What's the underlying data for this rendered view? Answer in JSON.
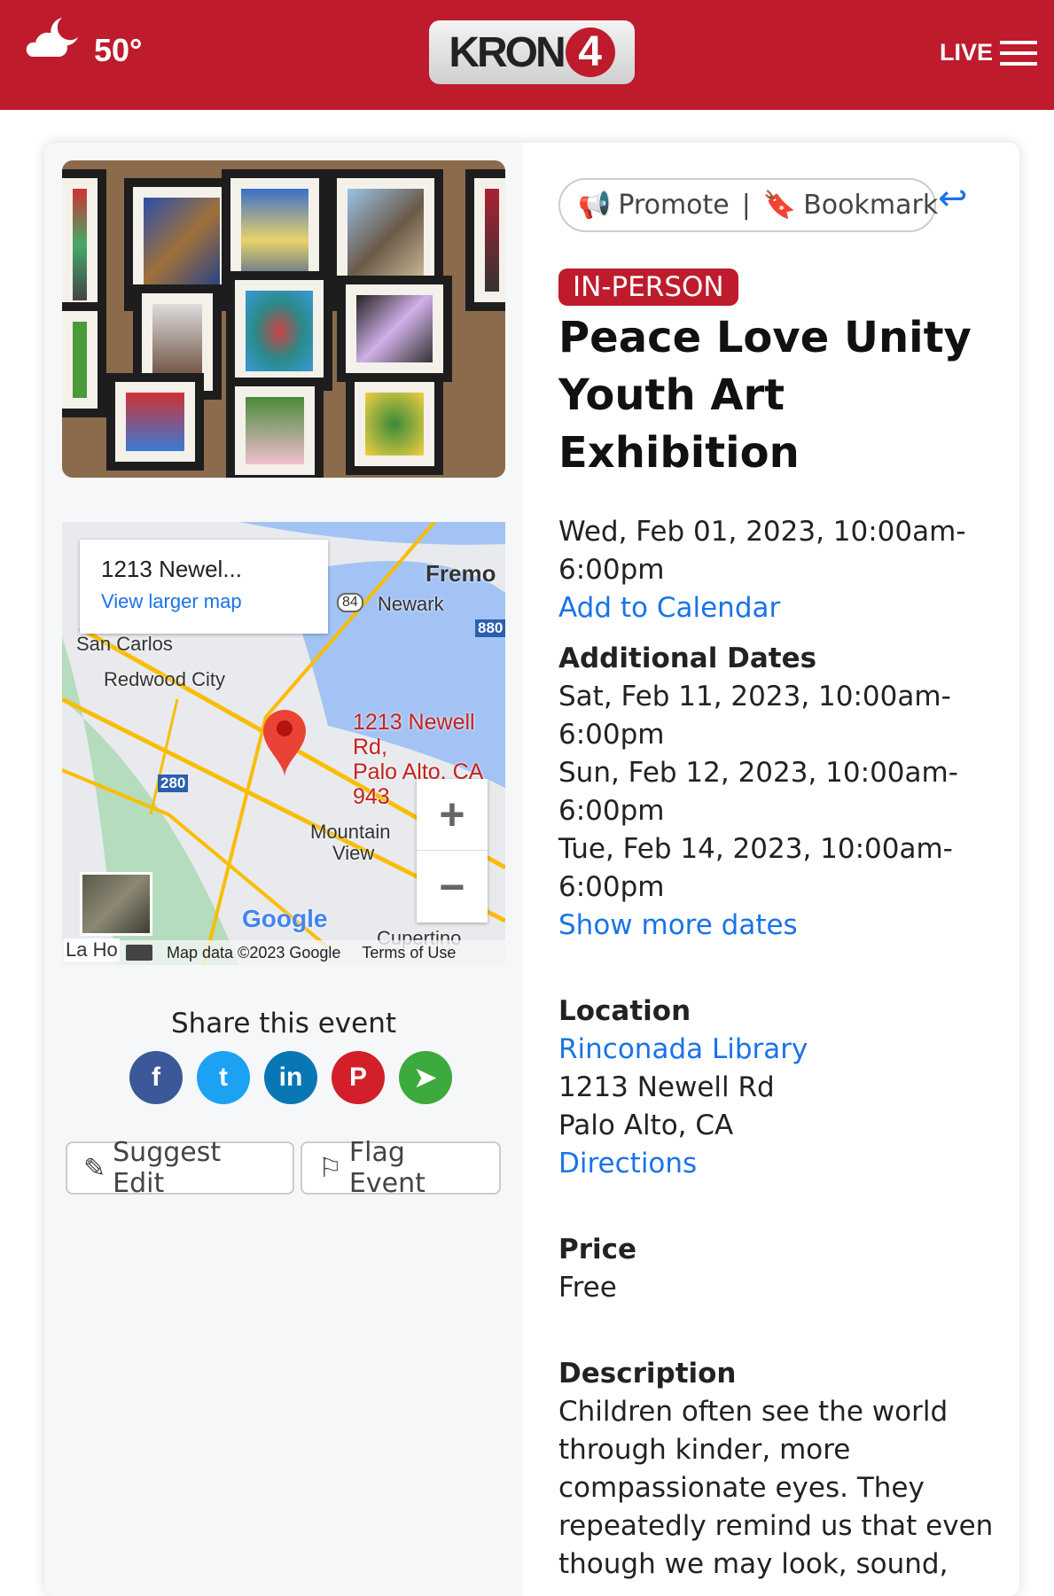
{
  "header": {
    "temperature": "50°",
    "weather_icon": "cloud-moon-icon",
    "logo_text": "KRON",
    "logo_number": "4",
    "live_label": "LIVE",
    "menu_icon": "hamburger-icon",
    "brand_color": "#BE1B2C"
  },
  "map": {
    "info_title": "1213 Newel...",
    "view_larger": "View larger map",
    "pin_label_1": "1213 Newell Rd,",
    "pin_label_2": "Palo Alto, CA 943",
    "places": [
      "Fremo",
      "Newark",
      "San Carlos",
      "Redwood City",
      "Mountain",
      "View",
      "Cupertino",
      "La Ho"
    ],
    "highways": [
      "84",
      "880",
      "280"
    ],
    "google": "Google",
    "map_data": "Map data ©2023 Google",
    "terms": "Terms of Use",
    "zoom_in": "+",
    "zoom_out": "−"
  },
  "share": {
    "title": "Share this event",
    "networks": [
      "facebook",
      "twitter",
      "linkedin",
      "pinterest",
      "telegram"
    ],
    "icons": [
      "f",
      "t",
      "in",
      "P",
      "➤"
    ]
  },
  "actions": {
    "suggest_edit": "Suggest Edit",
    "flag_event": "Flag Event",
    "promote": "Promote",
    "bookmark": "Bookmark",
    "separator": "|"
  },
  "event": {
    "badge": "IN-PERSON",
    "title": "Peace Love Unity Youth Art Exhibition",
    "date": "Wed, Feb 01, 2023, 10:00am-6:00pm",
    "add_calendar": "Add to Calendar",
    "additional_heading": "Additional Dates",
    "additional_dates": [
      "Sat, Feb 11, 2023, 10:00am-6:00pm",
      "Sun, Feb 12, 2023, 10:00am-6:00pm",
      "Tue, Feb 14, 2023, 10:00am-6:00pm"
    ],
    "show_more": "Show more dates",
    "location_heading": "Location",
    "venue": "Rinconada Library",
    "address1": "1213 Newell Rd",
    "address2": "Palo Alto, CA",
    "directions": "Directions",
    "price_heading": "Price",
    "price": "Free",
    "description_heading": "Description",
    "description": "Children often see the world through kinder, more compassionate eyes. They repeatedly remind us that even though we may look, sound,"
  }
}
